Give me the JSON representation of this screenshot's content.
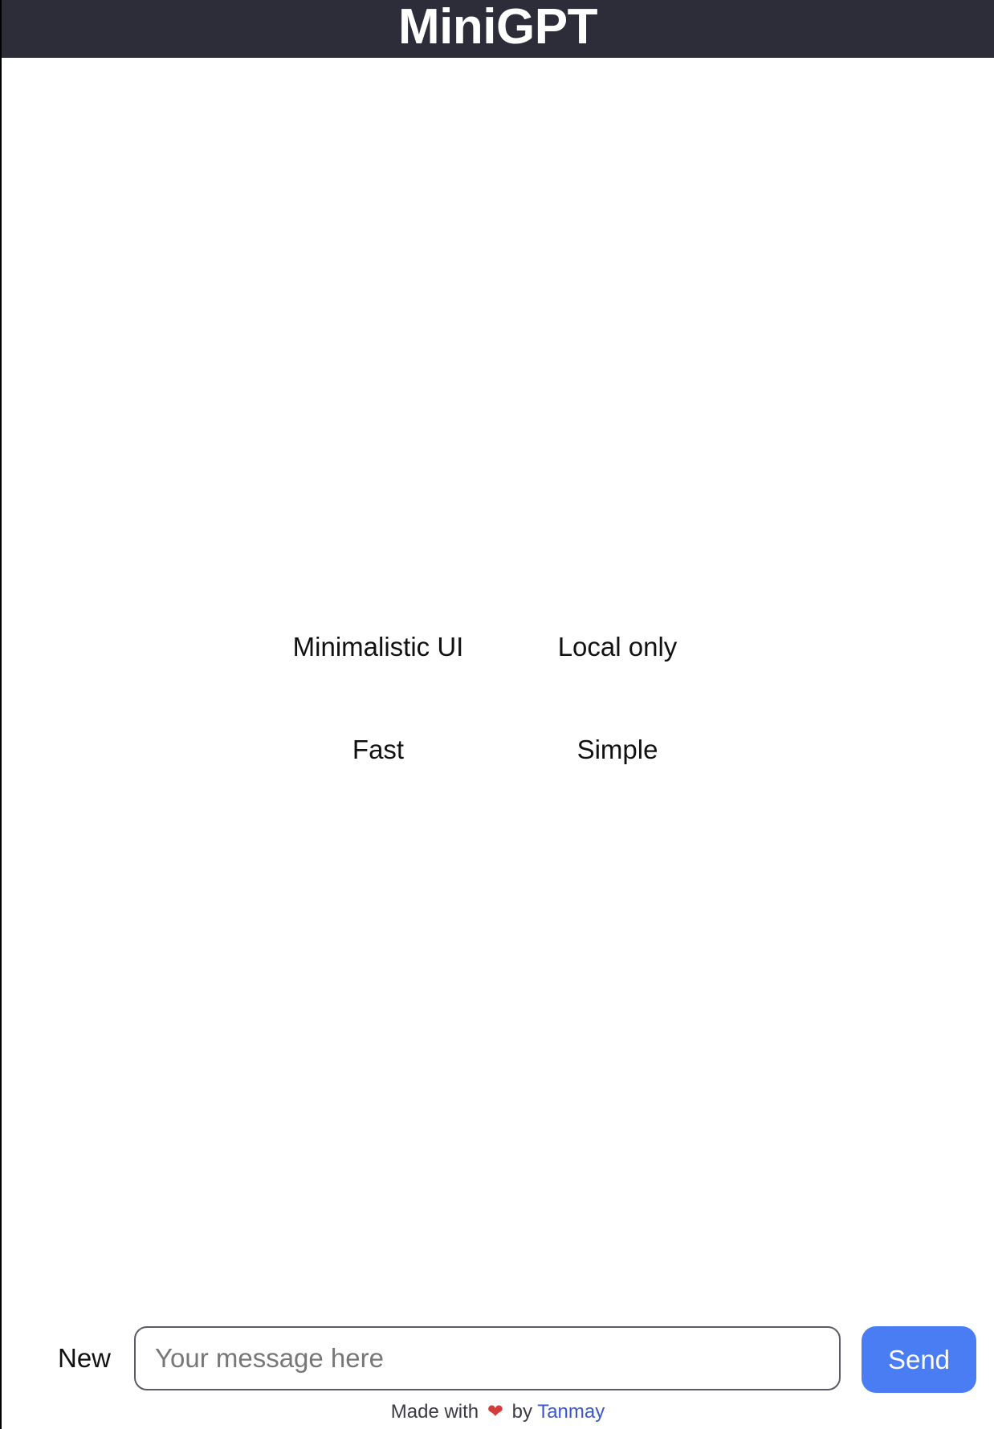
{
  "header": {
    "title": "MiniGPT"
  },
  "features": [
    {
      "label": "Minimalistic UI"
    },
    {
      "label": "Local only"
    },
    {
      "label": "Fast"
    },
    {
      "label": "Simple"
    }
  ],
  "composer": {
    "new_label": "New",
    "placeholder": "Your message here",
    "send_label": "Send"
  },
  "footer": {
    "prefix": "Made with",
    "heart_icon": "heart-icon",
    "by": "by",
    "author": "Tanmay"
  },
  "colors": {
    "header_bg": "#2d2d39",
    "send_button": "#4a7cf3",
    "heart": "#d63b3b",
    "link": "#3b57c8"
  }
}
